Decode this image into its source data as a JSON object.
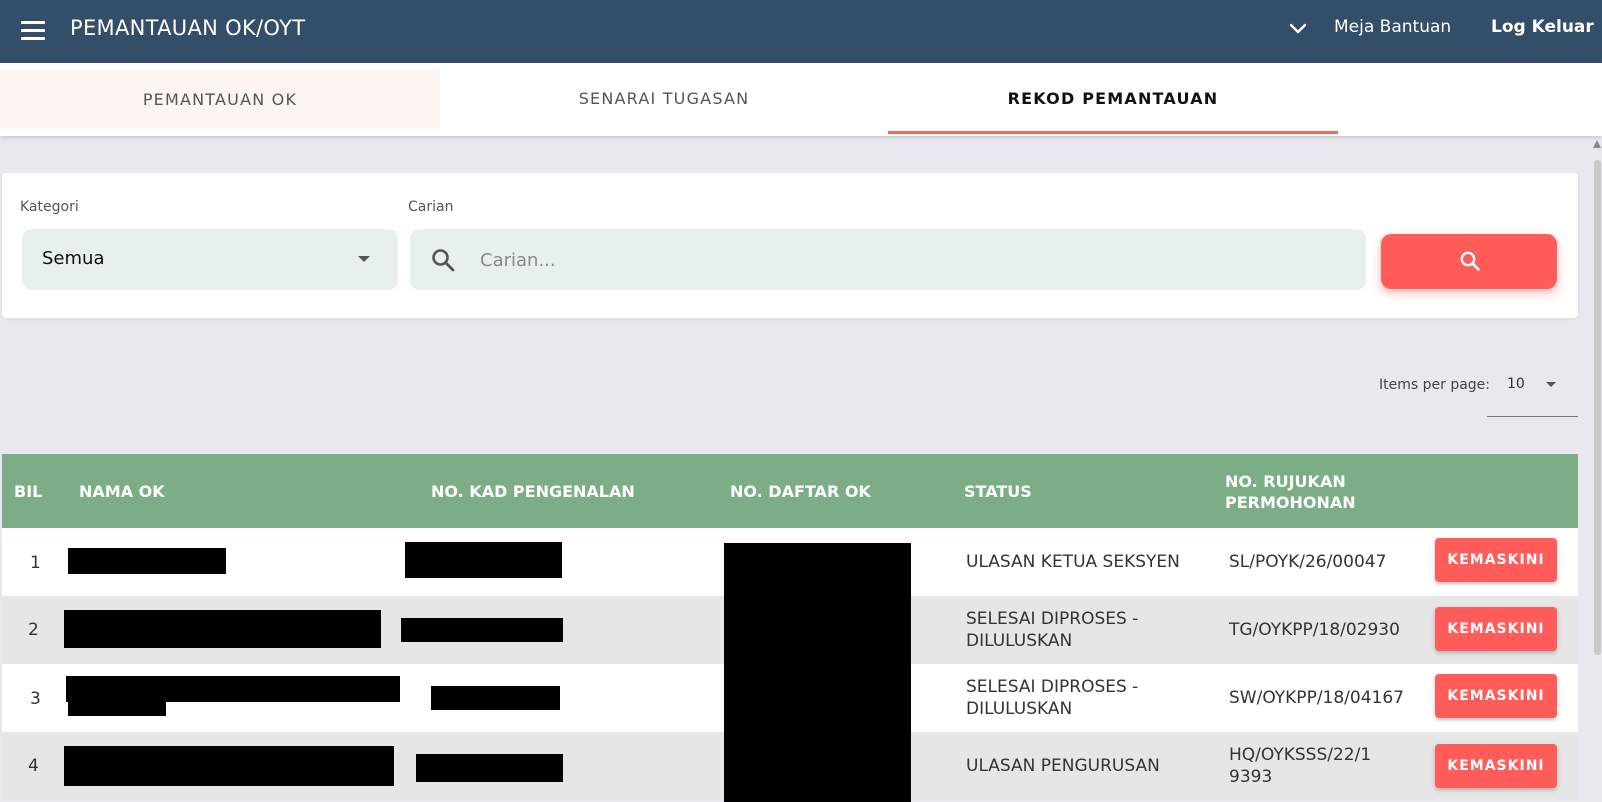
{
  "header": {
    "title": "PEMANTAUAN OK/OYT",
    "help_label": "Meja Bantuan",
    "logout_label": "Log Keluar"
  },
  "tabs": [
    {
      "label": "PEMANTAUAN OK"
    },
    {
      "label": "SENARAI TUGASAN"
    },
    {
      "label": "REKOD PEMANTAUAN",
      "active": true
    }
  ],
  "filters": {
    "category_label": "Kategori",
    "category_value": "Semua",
    "search_label": "Carian",
    "search_placeholder": "Carian..."
  },
  "pagination": {
    "items_per_page_label": "Items per page:",
    "items_per_page_value": "10"
  },
  "table": {
    "headers": {
      "bil": "BIL",
      "nama": "NAMA OK",
      "kad": "NO. KAD PENGENALAN",
      "daftar": "NO. DAFTAR OK",
      "status": "STATUS",
      "rujukan": "NO. RUJUKAN PERMOHONAN"
    },
    "action_label": "KEMASKINI",
    "rows": [
      {
        "bil": "1",
        "status": "ULASAN KETUA SEKSYEN",
        "rujukan": "SL/POYK/26/00047"
      },
      {
        "bil": "2",
        "status": "SELESAI DIPROSES - DILULUSKAN",
        "rujukan": "TG/OYKPP/18/02930"
      },
      {
        "bil": "3",
        "status": "SELESAI DIPROSES - DILULUSKAN",
        "rujukan": "SW/OYKPP/18/04167"
      },
      {
        "bil": "4",
        "status": "ULASAN PENGURUSAN",
        "rujukan": "HQ/OYKSSS/22/19393"
      }
    ]
  },
  "colors": {
    "topbar": "#324e68",
    "accent": "#ff5c5a",
    "tab_indicator": "#f06a55",
    "table_header": "#7cad87",
    "field_bg": "#e7f0ea"
  }
}
